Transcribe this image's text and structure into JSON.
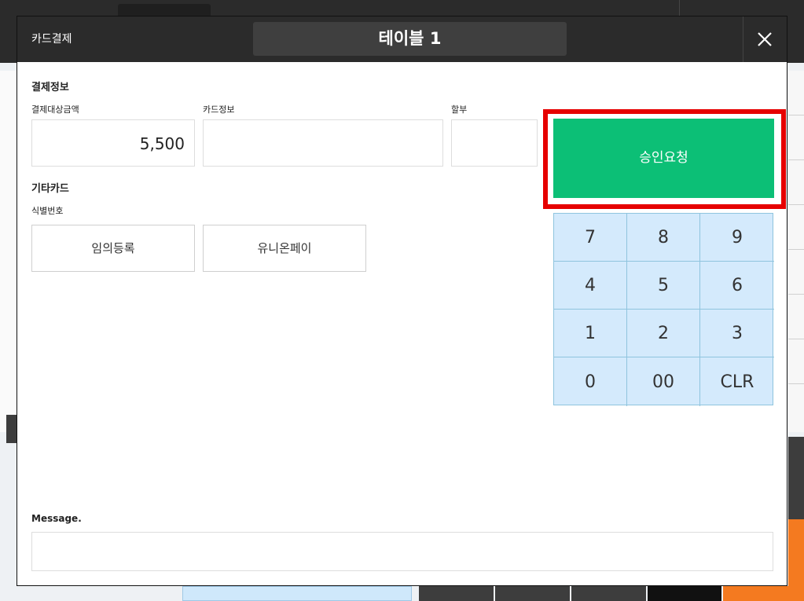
{
  "modal": {
    "caption": "카드결제",
    "title": "테이블 1"
  },
  "payment_info": {
    "section_title": "결제정보",
    "amount_label": "결제대상금액",
    "amount_value": "5,500",
    "card_info_label": "카드정보",
    "card_info_value": "",
    "installment_label": "할부",
    "installment_value": ""
  },
  "other_card": {
    "section_title": "기타카드",
    "id_label": "식별번호",
    "buttons": [
      "임의등록",
      "유니온페이"
    ]
  },
  "approve_button": "승인요청",
  "keypad": [
    "7",
    "8",
    "9",
    "4",
    "5",
    "6",
    "1",
    "2",
    "3",
    "0",
    "00",
    "CLR"
  ],
  "message": {
    "label": "Message.",
    "value": ""
  },
  "colors": {
    "header": "#2b2b2b",
    "approve": "#0cbf76",
    "highlight": "#e60000",
    "keypad": "#d4eafc"
  }
}
